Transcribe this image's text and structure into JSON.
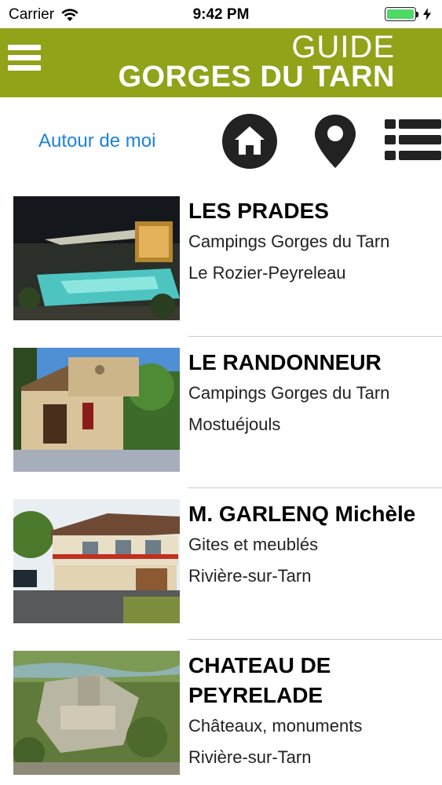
{
  "status_bar": {
    "carrier": "Carrier",
    "time": "9:42 PM",
    "battery_level": 1.0,
    "wifi_icon": "wifi-icon",
    "charging_icon": "bolt-icon"
  },
  "header": {
    "brand_top": "GUIDE",
    "brand_main": "GORGES DU TARN",
    "menu_icon": "hamburger-menu-icon",
    "color": "#92a219"
  },
  "toolbar": {
    "near_me_label": "Autour de moi",
    "home_icon": "home-icon",
    "map_icon": "map-pin-icon",
    "list_icon": "list-icon",
    "link_color": "#1a82e2"
  },
  "items": [
    {
      "title": "LES PRADES",
      "category": "Campings Gorges du Tarn",
      "location": "Le Rozier-Peyreleau"
    },
    {
      "title": "LE RANDONNEUR",
      "category": "Campings Gorges du Tarn",
      "location": "Mostuéjouls"
    },
    {
      "title": "M. GARLENQ Michèle",
      "category": "Gites et meublés",
      "location": "Rivière-sur-Tarn"
    },
    {
      "title": "CHATEAU DE PEYRELADE",
      "category": "Châteaux, monuments",
      "location": "Rivière-sur-Tarn"
    }
  ]
}
